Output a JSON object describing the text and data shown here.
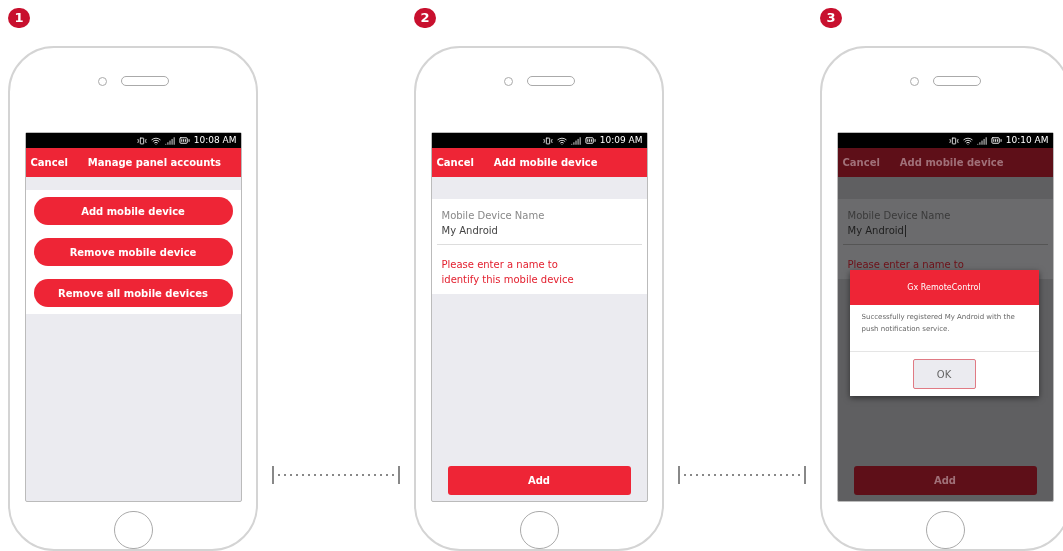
{
  "steps": [
    {
      "number": "1",
      "kind": "menu",
      "dimmed": false,
      "status_time": "10:08 AM",
      "header": {
        "cancel": "Cancel",
        "title": "Manage panel accounts"
      },
      "buttons": [
        "Add mobile device",
        "Remove mobile device",
        "Remove all mobile devices"
      ]
    },
    {
      "number": "2",
      "kind": "form",
      "dimmed": false,
      "status_time": "10:09 AM",
      "header": {
        "cancel": "Cancel",
        "title": "Add mobile device"
      },
      "field": {
        "label": "Mobile Device Name",
        "value": "My Android",
        "focused": false
      },
      "error": "Please enter a name to identify this mobile device",
      "submit": "Add"
    },
    {
      "number": "3",
      "kind": "form",
      "dimmed": true,
      "status_time": "10:10 AM",
      "header": {
        "cancel": "Cancel",
        "title": "Add mobile device"
      },
      "field": {
        "label": "Mobile Device Name",
        "value": "My Android",
        "focused": true
      },
      "error": "Please enter a name to",
      "submit": "Add",
      "dialog": {
        "title": "Gx RemoteControl",
        "message": "Successfully registered My Android with the push notification service.",
        "button": "OK"
      }
    }
  ]
}
